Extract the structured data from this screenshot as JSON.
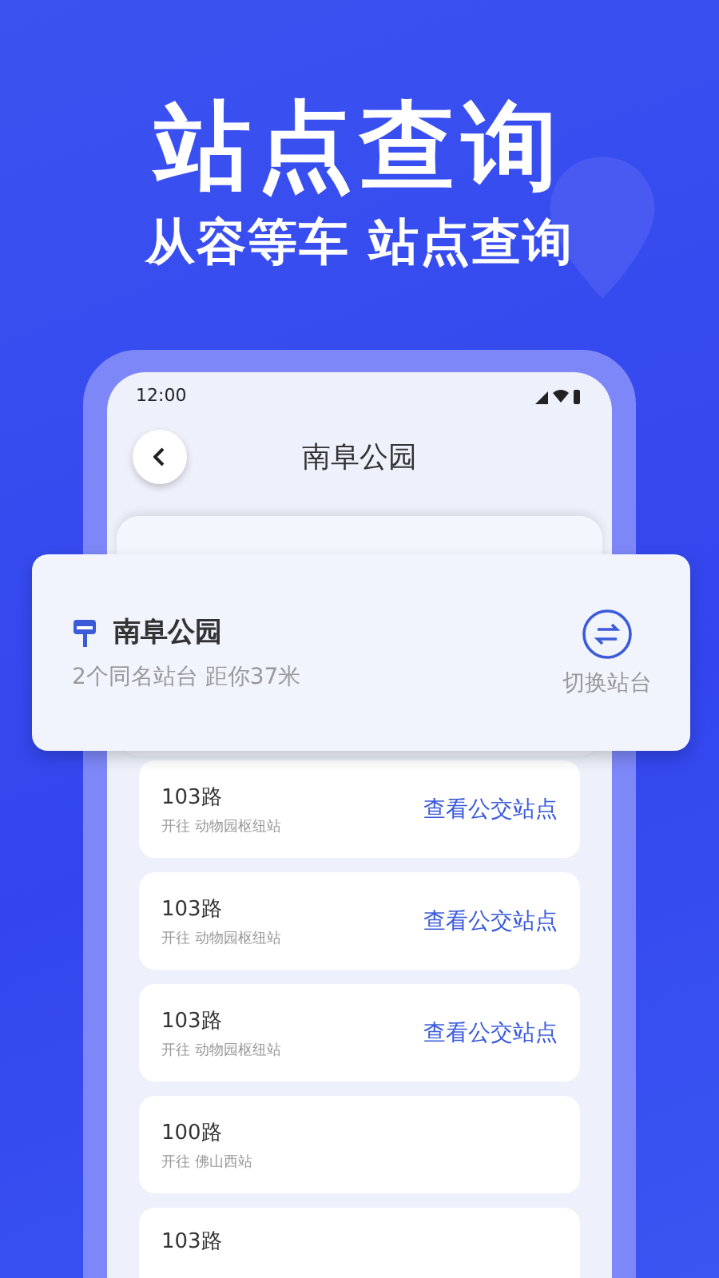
{
  "headline": "站点查询",
  "subtitle": "从容等车 站点查询",
  "phone": {
    "status_time": "12:00",
    "title": "南阜公园"
  },
  "station_card": {
    "name": "南阜公园",
    "info": "2个同名站台 距你37米",
    "switch_label": "切换站台"
  },
  "routes": [
    {
      "route": "103路",
      "destination": "开往 动物园枢纽站",
      "action": "查看公交站点"
    },
    {
      "route": "103路",
      "destination": "开往 动物园枢纽站",
      "action": "查看公交站点"
    },
    {
      "route": "103路",
      "destination": "开往 动物园枢纽站",
      "action": "查看公交站点"
    },
    {
      "route": "100路",
      "destination": "开往 佛山西站"
    },
    {
      "route": "103路"
    }
  ]
}
